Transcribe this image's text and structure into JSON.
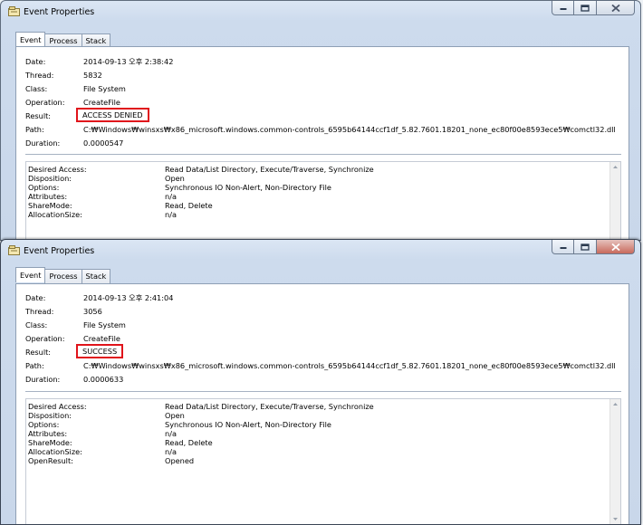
{
  "windows": [
    {
      "title": "Event Properties",
      "tabs": [
        "Event",
        "Process",
        "Stack"
      ],
      "fields": [
        {
          "label": "Date:",
          "value": "2014-09-13 오후 2:38:42"
        },
        {
          "label": "Thread:",
          "value": "5832"
        },
        {
          "label": "Class:",
          "value": "File System"
        },
        {
          "label": "Operation:",
          "value": "CreateFile"
        },
        {
          "label": "Result:",
          "value": "ACCESS DENIED"
        },
        {
          "label": "Path:",
          "value": "C:₩Windows₩winsxs₩x86_microsoft.windows.common-controls_6595b64144ccf1df_5.82.7601.18201_none_ec80f00e8593ece5₩comctl32.dll"
        },
        {
          "label": "Duration:",
          "value": "0.0000547"
        }
      ],
      "details": [
        {
          "label": "Desired Access:",
          "value": "Read Data/List Directory, Execute/Traverse, Synchronize"
        },
        {
          "label": "Disposition:",
          "value": "Open"
        },
        {
          "label": "Options:",
          "value": "Synchronous IO Non-Alert, Non-Directory File"
        },
        {
          "label": "Attributes:",
          "value": "n/a"
        },
        {
          "label": "ShareMode:",
          "value": "Read, Delete"
        },
        {
          "label": "AllocationSize:",
          "value": "n/a"
        }
      ],
      "highlight_color": "#e0141b"
    },
    {
      "title": "Event Properties",
      "tabs": [
        "Event",
        "Process",
        "Stack"
      ],
      "fields": [
        {
          "label": "Date:",
          "value": "2014-09-13 오후 2:41:04"
        },
        {
          "label": "Thread:",
          "value": "3056"
        },
        {
          "label": "Class:",
          "value": "File System"
        },
        {
          "label": "Operation:",
          "value": "CreateFile"
        },
        {
          "label": "Result:",
          "value": "SUCCESS"
        },
        {
          "label": "Path:",
          "value": "C:₩Windows₩winsxs₩x86_microsoft.windows.common-controls_6595b64144ccf1df_5.82.7601.18201_none_ec80f00e8593ece5₩comctl32.dll"
        },
        {
          "label": "Duration:",
          "value": "0.0000633"
        }
      ],
      "details": [
        {
          "label": "Desired Access:",
          "value": "Read Data/List Directory, Execute/Traverse, Synchronize"
        },
        {
          "label": "Disposition:",
          "value": "Open"
        },
        {
          "label": "Options:",
          "value": "Synchronous IO Non-Alert, Non-Directory File"
        },
        {
          "label": "Attributes:",
          "value": "n/a"
        },
        {
          "label": "ShareMode:",
          "value": "Read, Delete"
        },
        {
          "label": "AllocationSize:",
          "value": "n/a"
        },
        {
          "label": "OpenResult:",
          "value": "Opened"
        }
      ],
      "highlight_color": "#e0141b"
    }
  ]
}
